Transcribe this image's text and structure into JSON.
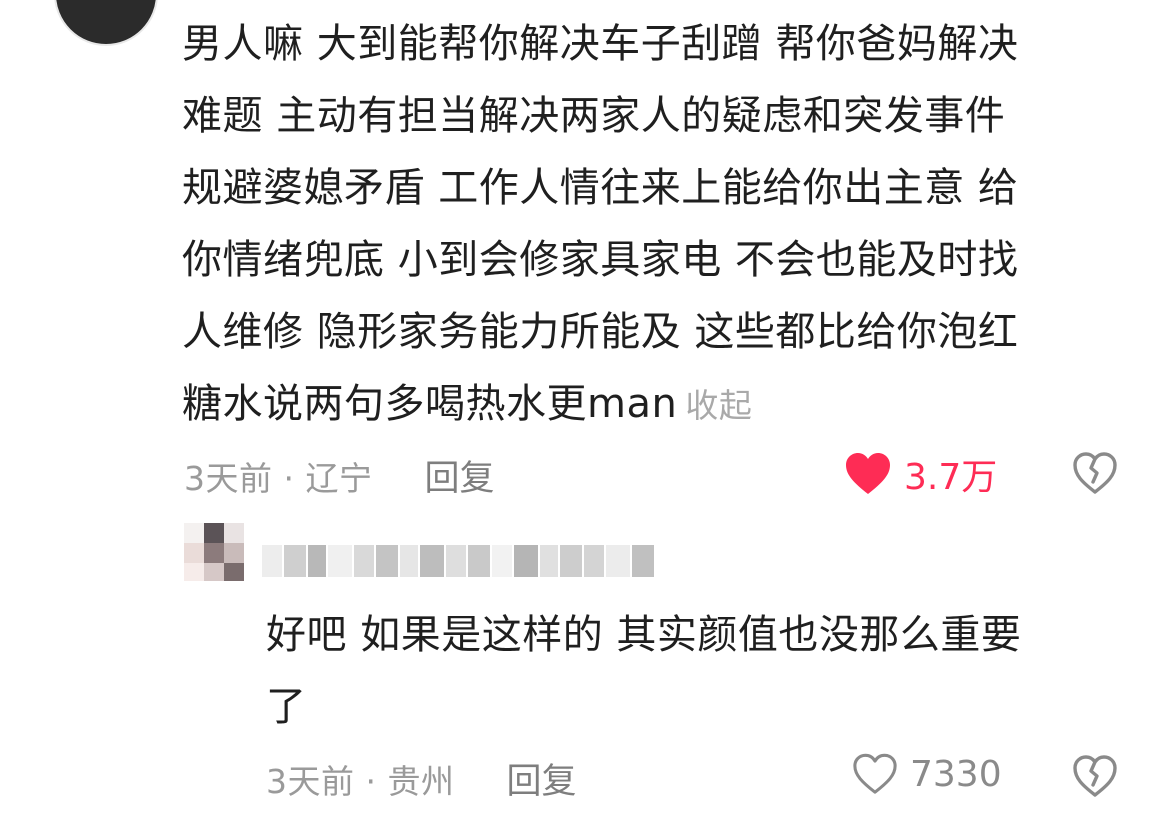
{
  "comment": {
    "lines": [
      "男人嘛 大到能帮你解决车子刮蹭 帮你爸妈解决",
      "难题 主动有担当解决两家人的疑虑和突发事件",
      "规避婆媳矛盾 工作人情往来上能给你出主意 给",
      "你情绪兜底 小到会修家具家电 不会也能及时找",
      "人维修 隐形家务能力所能及 这些都比给你泡红",
      "糖水说两句多喝热水更man"
    ],
    "collapse_label": "收起",
    "time_location": "3天前 · 辽宁",
    "reply_label": "回复",
    "like_count": "3.7万",
    "liked": true,
    "like_color": "#fe2c55",
    "heart_icon": "heart-filled-icon",
    "dislike_icon": "broken-heart-icon"
  },
  "reply": {
    "lines": [
      "好吧 如果是这样的 其实颜值也没那么重要",
      "了"
    ],
    "time_location": "3天前 · 贵州",
    "reply_label": "回复",
    "like_count": "7330",
    "liked": false,
    "heart_icon": "heart-outline-icon",
    "dislike_icon": "broken-heart-icon"
  }
}
